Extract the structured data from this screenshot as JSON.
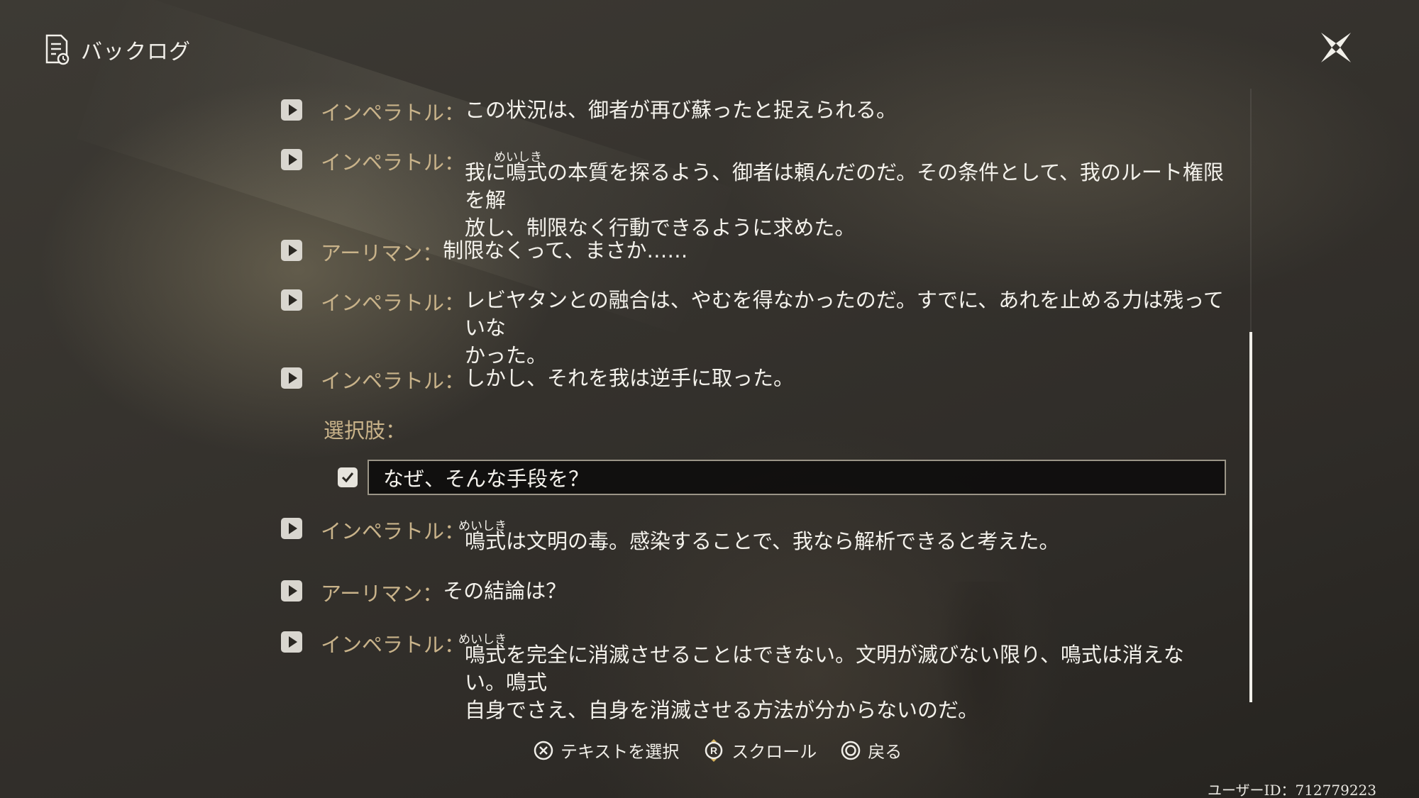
{
  "header": {
    "title": "バックログ",
    "icon": "backlog-document-icon"
  },
  "close_icon": "close-x-icon",
  "entries": [
    {
      "speaker": "インペラトル：",
      "text": "この状況は、御者が再び蘇ったと捉えられる。"
    },
    {
      "speaker": "インペラトル：",
      "ruby": "めいしき",
      "text": "我に鳴式の本質を探るよう、御者は頼んだのだ。その条件として、我のルート権限を解\n放し、制限なく行動できるように求めた。"
    },
    {
      "speaker": "アーリマン：",
      "text": "制限なくって、まさか……"
    },
    {
      "speaker": "インペラトル：",
      "text": "レビヤタンとの融合は、やむを得なかったのだ。すでに、あれを止める力は残っていな\nかった。"
    },
    {
      "speaker": "インペラトル：",
      "text": "しかし、それを我は逆手に取った。"
    },
    {
      "speaker": "インペラトル：",
      "ruby": "めいしき",
      "text": "鳴式は文明の毒。感染することで、我なら解析できると考えた。"
    },
    {
      "speaker": "アーリマン：",
      "text": "その結論は？"
    },
    {
      "speaker": "インペラトル：",
      "ruby": "めいしき",
      "text": "鳴式を完全に消滅させることはできない。文明が滅びない限り、鳴式は消えない。鳴式\n自身でさえ、自身を消滅させる方法が分からないのだ。"
    }
  ],
  "choice": {
    "label": "選択肢：",
    "option": "なぜ、そんな手段を？",
    "selected": true
  },
  "footer": {
    "select_hint": "テキストを選択",
    "select_button": "✕",
    "scroll_hint": "スクロール",
    "scroll_button": "R",
    "back_hint": "戻る",
    "back_button": "◯"
  },
  "user_id": "ユーザーID：712779223",
  "colors": {
    "speaker": "#c9b38a",
    "text": "#f4f2ec",
    "choice_bg": "#0c0b0a"
  }
}
